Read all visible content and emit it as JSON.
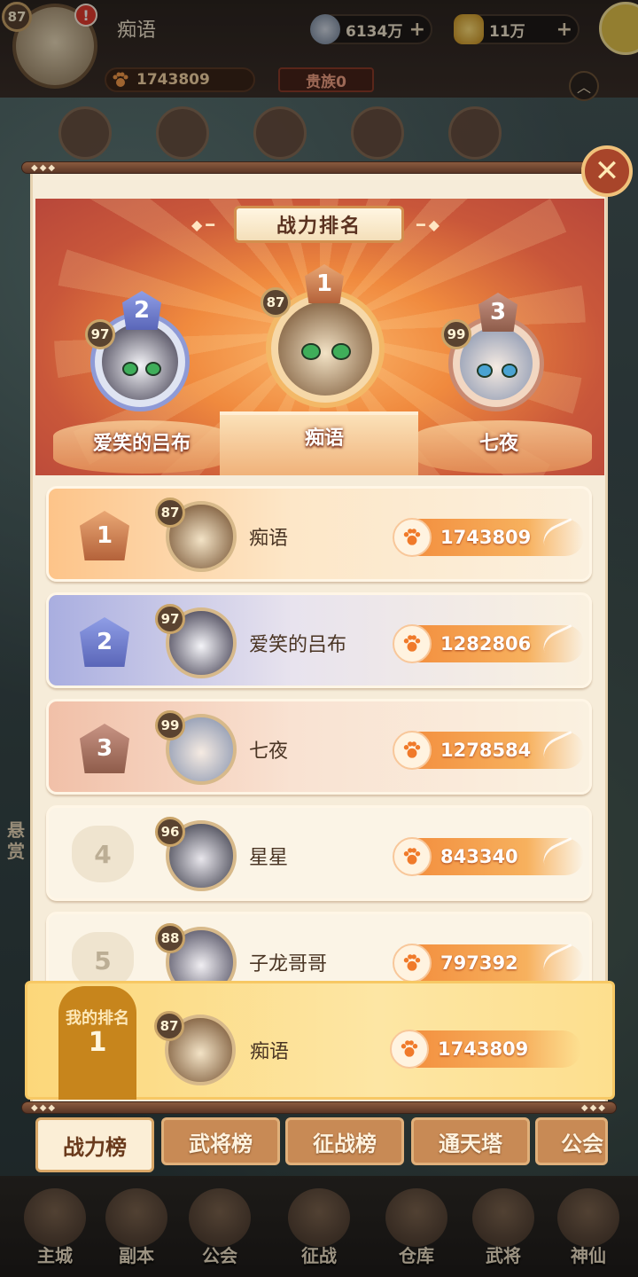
{
  "top_bar": {
    "level": "87",
    "player_name": "痴语",
    "alert": "!",
    "silver": "6134万",
    "gold": "11万",
    "power": "1743809",
    "noble": "贵族0"
  },
  "panel": {
    "title": "战力排名",
    "close_label": "✕"
  },
  "podium": [
    {
      "rank": "2",
      "level": "97",
      "name": "爱笑的吕布"
    },
    {
      "rank": "1",
      "level": "87",
      "name": "痴语"
    },
    {
      "rank": "3",
      "level": "99",
      "name": "七夜"
    }
  ],
  "rows": [
    {
      "rank": "1",
      "level": "87",
      "name": "痴语",
      "power": "1743809"
    },
    {
      "rank": "2",
      "level": "97",
      "name": "爱笑的吕布",
      "power": "1282806"
    },
    {
      "rank": "3",
      "level": "99",
      "name": "七夜",
      "power": "1278584"
    },
    {
      "rank": "4",
      "level": "96",
      "name": "星星",
      "power": "843340"
    },
    {
      "rank": "5",
      "level": "88",
      "name": "子龙哥哥",
      "power": "797392"
    }
  ],
  "my_rank": {
    "label": "我的排名",
    "rank": "1",
    "level": "87",
    "name": "痴语",
    "power": "1743809"
  },
  "tabs": [
    {
      "label": "战力榜",
      "active": true
    },
    {
      "label": "武将榜"
    },
    {
      "label": "征战榜"
    },
    {
      "label": "通天塔"
    },
    {
      "label": "公会"
    }
  ],
  "bottom_nav": [
    {
      "label": "主城"
    },
    {
      "label": "副本"
    },
    {
      "label": "公会"
    },
    {
      "label": "征战"
    },
    {
      "label": "仓库"
    },
    {
      "label": "武将"
    },
    {
      "label": "神仙"
    }
  ],
  "side_text": {
    "left_label": "悬赏"
  },
  "colors": {
    "accent_orange": "#f28a3a",
    "panel_bg": "#f6ecd9",
    "rank1": "#c27a50",
    "rank2": "#6a78c8",
    "rank3": "#b07a6a"
  }
}
